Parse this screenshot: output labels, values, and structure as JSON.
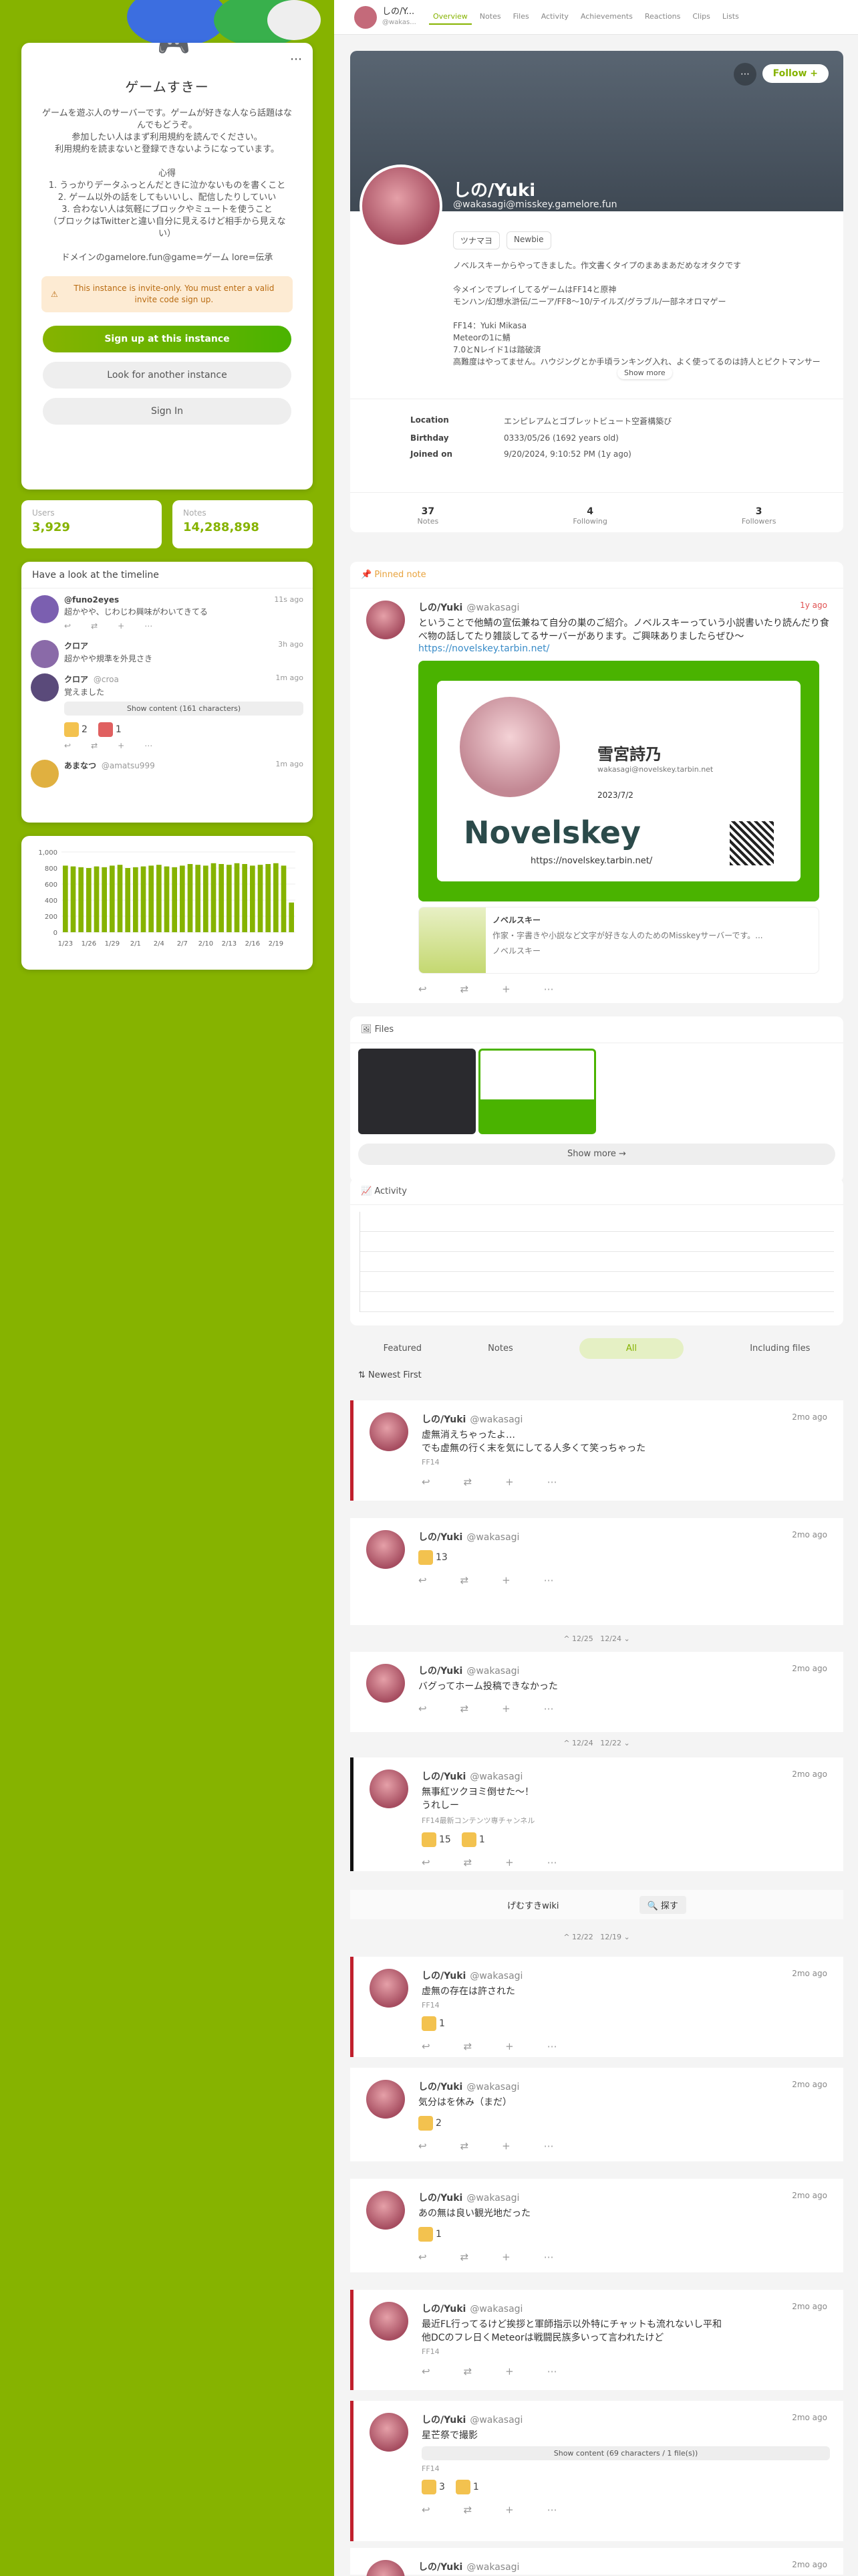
{
  "server": {
    "name": "ゲームすきー",
    "description": "ゲームを遊ぶ人のサーバーです。ゲームが好きな人なら話題はなんでもどうぞ。\n参加したい人はまず利用規約を読んでください。\n利用規約を読まないと登録できないようになっています。\n\n心得\n1. うっかりデータふっとんだときに泣かないものを書くこと\n2. ゲーム以外の話をしてもいいし、配信したりしていい\n3. 合わない人は気軽にブロックやミュートを使うこと\n（ブロックはTwitterと違い自分に見えるけど相手から見えない）\n\nドメインのgamelore.fun@game=ゲーム lore=伝承",
    "invite_notice": "This instance is invite-only. You must enter a valid invite code sign up.",
    "signup_label": "Sign up at this instance",
    "look_label": "Look for another instance",
    "signin_label": "Sign In",
    "menu_icon": "ellipsis-icon"
  },
  "stats": {
    "users_label": "Users",
    "users_value": "3,929",
    "notes_label": "Notes",
    "notes_value": "14,288,898"
  },
  "timeline_preview": {
    "title": "Have a look at the timeline",
    "notes": [
      {
        "user": "@funo2eyes",
        "time": "11s ago",
        "text": "超かやや、じわじわ興味がわいてきてる"
      },
      {
        "user": "クロア",
        "time": "3h ago",
        "text": "超かやや規準を外見さき"
      },
      {
        "user": "クロア",
        "handle": "@croa",
        "time": "1m ago",
        "text": "覚えました",
        "show_content": "Show content (161 characters)",
        "reactions": [
          "2",
          "1"
        ]
      },
      {
        "user": "あまなつ",
        "handle": "@amatsu999",
        "time": "1m ago",
        "text": ""
      }
    ]
  },
  "chart_data": {
    "type": "bar",
    "categories": [
      "1/23",
      "1/24",
      "1/25",
      "1/26",
      "1/27",
      "1/28",
      "1/29",
      "1/30",
      "1/31",
      "2/1",
      "2/2",
      "2/3",
      "2/4",
      "2/5",
      "2/6",
      "2/7",
      "2/8",
      "2/9",
      "2/10",
      "2/11",
      "2/12",
      "2/13",
      "2/14",
      "2/15",
      "2/16",
      "2/17",
      "2/18",
      "2/19",
      "2/20",
      "2/21"
    ],
    "values": [
      830,
      820,
      810,
      800,
      820,
      810,
      830,
      840,
      800,
      810,
      820,
      830,
      840,
      820,
      810,
      830,
      850,
      840,
      830,
      860,
      850,
      840,
      860,
      850,
      830,
      840,
      850,
      860,
      830,
      370
    ],
    "tick_labels": [
      "1/23",
      "1/26",
      "1/29",
      "2/1",
      "2/4",
      "2/7",
      "2/10",
      "2/13",
      "2/16",
      "2/19"
    ],
    "y_ticks": [
      "1,000",
      "800",
      "600",
      "400",
      "200",
      "0"
    ],
    "ylim": [
      0,
      1000
    ],
    "title": "",
    "xlabel": "",
    "ylabel": "",
    "color": "#86b300"
  },
  "topbar": {
    "name": "しの/Y...",
    "handle": "@wakas...",
    "tabs": [
      "Overview",
      "Notes",
      "Files",
      "Activity",
      "Achievements",
      "Reactions",
      "Clips",
      "Lists"
    ]
  },
  "profile": {
    "name": "しの/Yuki",
    "handle": "@wakasagi@misskey.gamelore.fun",
    "follow_label": "Follow",
    "roles": [
      "ツナマヨ",
      "Newbie"
    ],
    "bio": "ノベルスキーからやってきました。作文書くタイプのまあまあだめなオタクです\n\n今メインでプレイしてるゲームはFF14と原神\nモンハン/幻想水滸伝/ニーア/FF8〜10/テイルズ/グラブル/一部ネオロマゲー\n\nFF14：Yuki Mikasa\nMeteorの1に鯖\n7.0とNレイド1は踏破済\n高難度はやってません。ハウジングとか手頃ランキング入れ、よく使ってるのは詩人とピクトマンサー",
    "show_more": "Show more",
    "fields": [
      {
        "key": "Location",
        "value": "エンピレアムとゴブレットビュート空蒼構築び"
      },
      {
        "key": "Birthday",
        "value": "0333/05/26 (1692 years old)"
      },
      {
        "key": "Joined on",
        "value": "9/20/2024, 9:10:52 PM (1y ago)"
      }
    ],
    "counts": [
      {
        "n": "37",
        "l": "Notes"
      },
      {
        "n": "4",
        "l": "Following"
      },
      {
        "n": "3",
        "l": "Followers"
      }
    ]
  },
  "pinned": {
    "label": "Pinned note",
    "name": "しの/Yuki",
    "handle": "@wakasagi",
    "time": "1y ago",
    "text": "ということで他鯖の宣伝兼ねて自分の巣のご紹介。ノベルスキーっていう小説書いたり読んだり食べ物の話してたり雑談してるサーバーがあります。ご興味ありましたらぜひ〜",
    "link": "https://novelskey.tarbin.net/",
    "card_title": "雪宮詩乃",
    "card_handle": "wakasagi@novelskey.tarbin.net",
    "card_date": "2023/7/2",
    "logo_text": "Novelskey",
    "logo_url": "https://novelskey.tarbin.net/",
    "preview_title": "ノベルスキー",
    "preview_desc": "作家・字書きや小説など文字が好きな人のためのMisskeyサーバーです。...",
    "preview_site": "ノベルスキー"
  },
  "files": {
    "label": "Files",
    "show_more": "Show more"
  },
  "activity": {
    "label": "Activity"
  },
  "filters": {
    "featured": "Featured",
    "notes": "Notes",
    "all": "All",
    "files": "Including files",
    "sort": "Newest First"
  },
  "timeline": [
    {
      "name": "しの/Yuki",
      "handle": "@wakasagi",
      "time": "2mo ago",
      "text": "虚無消えちゃったよ…\nでも虚無の行く末を気にしてる人多くて笑っちゃった",
      "via": "FF14",
      "mark": "marked"
    },
    {
      "name": "しの/Yuki",
      "handle": "@wakasagi",
      "time": "2mo ago",
      "text": "",
      "reaction": "13",
      "mark": ""
    },
    {
      "name": "しの/Yuki",
      "handle": "@wakasagi",
      "time": "2mo ago",
      "text": "バグってホーム投稿できなかった",
      "mark": ""
    },
    {
      "name": "しの/Yuki",
      "handle": "@wakasagi",
      "time": "2mo ago",
      "text": "無事紅ツクヨミ倒せた〜！\nうれしー",
      "via": "FF14最新コンテンツ専チャンネル",
      "reactions": [
        "15",
        "1"
      ],
      "mark": "blk"
    },
    {
      "name": "しの/Yuki",
      "handle": "@wakasagi",
      "time": "2mo ago",
      "text": "虚無の存在は許された",
      "via": "FF14",
      "reaction": "1",
      "mark": "marked"
    },
    {
      "name": "しの/Yuki",
      "handle": "@wakasagi",
      "time": "2mo ago",
      "text": "気分はを休み（まだ）",
      "reaction": "2",
      "mark": ""
    },
    {
      "name": "しの/Yuki",
      "handle": "@wakasagi",
      "time": "2mo ago",
      "text": "あの無は良い観光地だった",
      "reaction": "1",
      "mark": ""
    },
    {
      "name": "しの/Yuki",
      "handle": "@wakasagi",
      "time": "2mo ago",
      "text": "最近FL行ってるけど挨拶と軍師指示以外特にチャットも流れないし平和\n他DCのフレ日くMeteorは戦闘民族多いって言われたけど",
      "via": "FF14",
      "mark": "marked"
    },
    {
      "name": "しの/Yuki",
      "handle": "@wakasagi",
      "time": "2mo ago",
      "text": "星芒祭で撮影",
      "show_content": "Show content (69 characters / 1 file(s))",
      "via": "FF14",
      "reactions": [
        "3",
        "1"
      ],
      "mark": "marked"
    },
    {
      "name": "しの/Yuki",
      "handle": "@wakasagi",
      "time": "2mo ago",
      "text": "",
      "mark": ""
    }
  ],
  "date_seps": [
    {
      "a": "12/25",
      "b": "12/24"
    },
    {
      "a": "12/24",
      "b": "12/22"
    },
    {
      "a": "12/22",
      "b": "12/19"
    }
  ],
  "wiki": {
    "label": "げむすきwiki",
    "search": "探す"
  }
}
